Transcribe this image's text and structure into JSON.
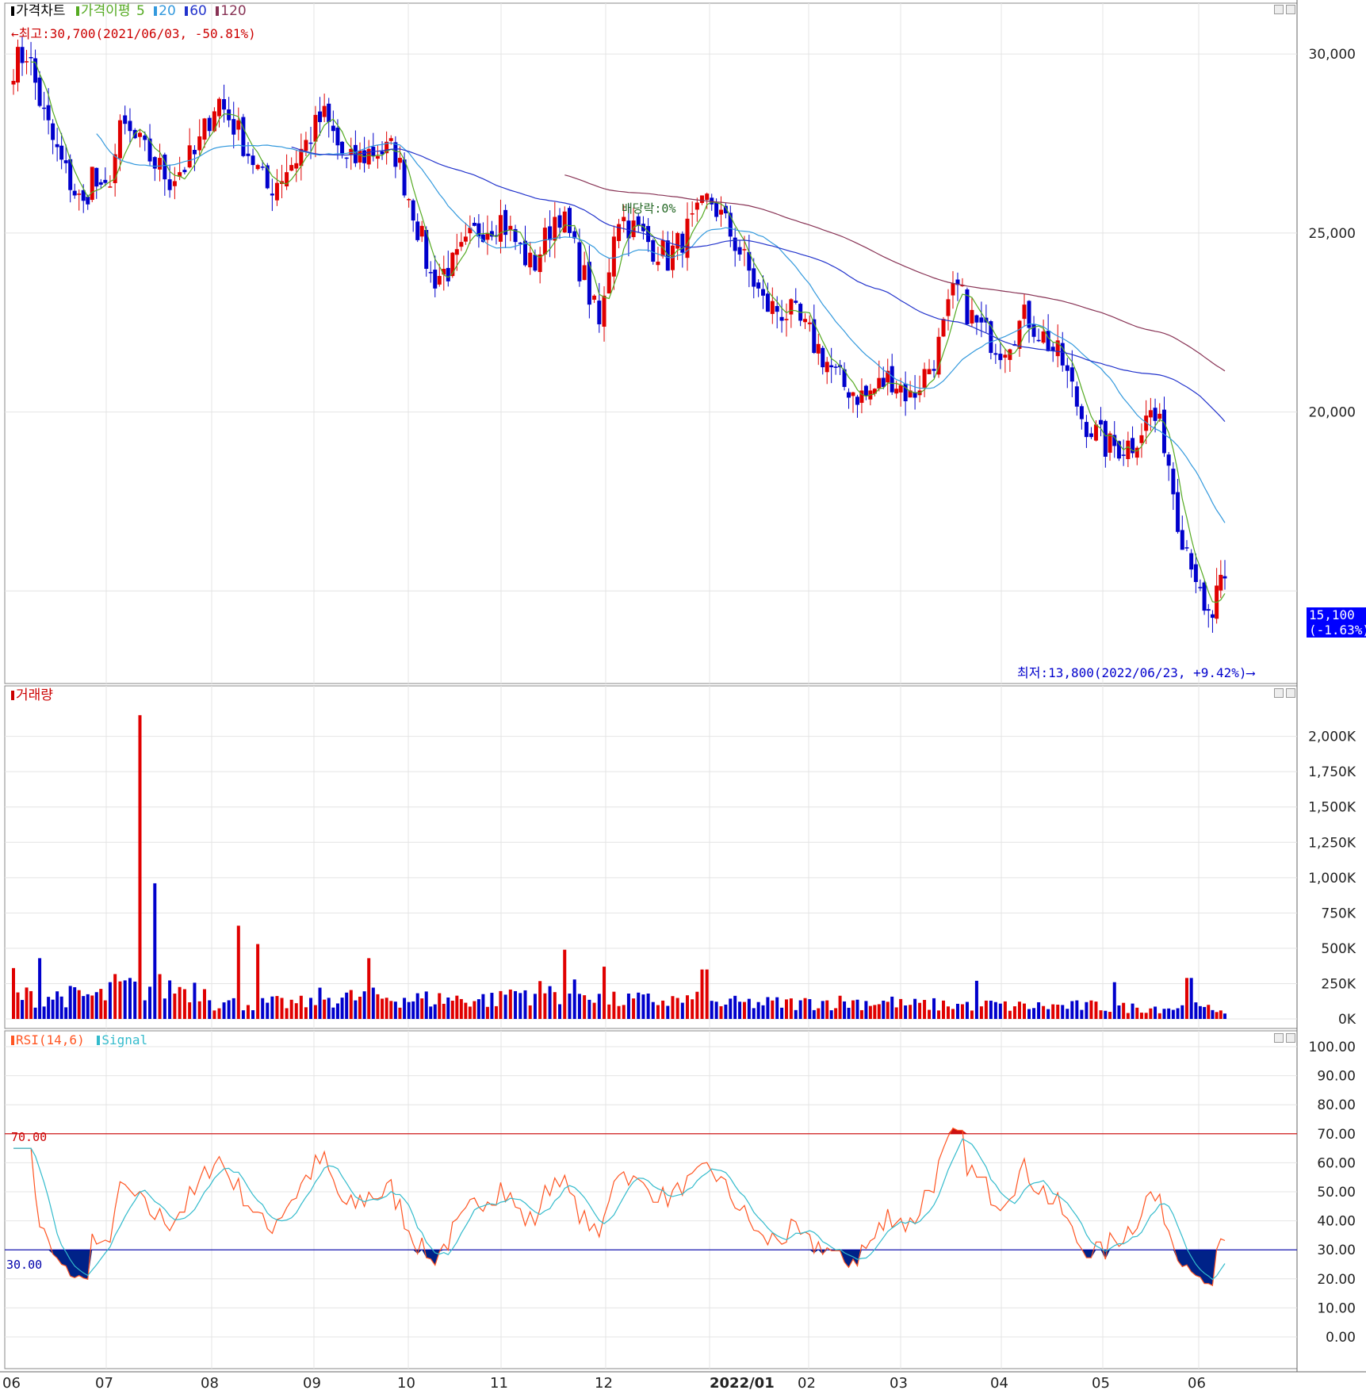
{
  "price_panel": {
    "legend": {
      "price_chart": "가격차트",
      "ma_label": "가격이평",
      "ma_periods": [
        "5",
        "20",
        "60",
        "120"
      ]
    },
    "high_annotation": "←최고:30,700(2021/06/03, -50.81%)",
    "low_annotation": "최저:13,800(2022/06/23, +9.42%)⟶",
    "event_marker": "배당락:0%",
    "last_price": "15,100",
    "last_change": "(-1.63%)"
  },
  "volume_panel": {
    "legend": "거래량"
  },
  "rsi_panel": {
    "legend_rsi": "RSI(14,6)",
    "legend_signal": "Signal",
    "upper_level_label": "70.00",
    "lower_level_label": "30.00"
  },
  "colors": {
    "up": "#e00000",
    "down": "#0000cc",
    "ma5": "#55aa22",
    "ma20": "#3399dd",
    "ma60": "#2233cc",
    "ma120": "#883355",
    "rsi": "#ff5522",
    "signal": "#33bbcc",
    "overbought_fill": "#cc1111",
    "oversold_fill": "#002288"
  },
  "chart_data": [
    {
      "type": "candlestick",
      "title": "가격차트",
      "y_ticks": [
        "30,000",
        "25,000",
        "20,000"
      ],
      "ylim": [
        13300,
        31200
      ],
      "x_ticks": [
        "06",
        "07",
        "08",
        "09",
        "10",
        "11",
        "12",
        "2022/01",
        "02",
        "03",
        "04",
        "05",
        "06"
      ],
      "series": [
        {
          "name": "Close",
          "anchors": [
            {
              "m": 0.0,
              "v": 29700
            },
            {
              "m": 0.15,
              "v": 30100
            },
            {
              "m": 0.3,
              "v": 28500
            },
            {
              "m": 0.5,
              "v": 27000
            },
            {
              "m": 0.75,
              "v": 25700
            },
            {
              "m": 0.85,
              "v": 26700
            },
            {
              "m": 0.95,
              "v": 25900
            },
            {
              "m": 1.0,
              "v": 26200
            },
            {
              "m": 1.15,
              "v": 28000
            },
            {
              "m": 1.35,
              "v": 27300
            },
            {
              "m": 1.6,
              "v": 26500
            },
            {
              "m": 1.85,
              "v": 27200
            },
            {
              "m": 2.05,
              "v": 28800
            },
            {
              "m": 2.3,
              "v": 27600
            },
            {
              "m": 2.55,
              "v": 26200
            },
            {
              "m": 2.85,
              "v": 27200
            },
            {
              "m": 3.1,
              "v": 28300
            },
            {
              "m": 3.35,
              "v": 26900
            },
            {
              "m": 3.6,
              "v": 27300
            },
            {
              "m": 3.85,
              "v": 27300
            },
            {
              "m": 4.05,
              "v": 25700
            },
            {
              "m": 4.25,
              "v": 23700
            },
            {
              "m": 4.5,
              "v": 24100
            },
            {
              "m": 4.75,
              "v": 25100
            },
            {
              "m": 5.0,
              "v": 25400
            },
            {
              "m": 5.3,
              "v": 24000
            },
            {
              "m": 5.55,
              "v": 25700
            },
            {
              "m": 5.8,
              "v": 23700
            },
            {
              "m": 5.95,
              "v": 22300
            },
            {
              "m": 6.1,
              "v": 25600
            },
            {
              "m": 6.35,
              "v": 24900
            },
            {
              "m": 6.6,
              "v": 24300
            },
            {
              "m": 6.9,
              "v": 25500
            },
            {
              "m": 7.0,
              "v": 26000
            },
            {
              "m": 7.25,
              "v": 24800
            },
            {
              "m": 7.55,
              "v": 23000
            },
            {
              "m": 7.85,
              "v": 22700
            },
            {
              "m": 8.15,
              "v": 21600
            },
            {
              "m": 8.35,
              "v": 20800
            },
            {
              "m": 8.6,
              "v": 20400
            },
            {
              "m": 8.9,
              "v": 21000
            },
            {
              "m": 9.1,
              "v": 20400
            },
            {
              "m": 9.35,
              "v": 21600
            },
            {
              "m": 9.55,
              "v": 23500
            },
            {
              "m": 9.75,
              "v": 22400
            },
            {
              "m": 10.0,
              "v": 21800
            },
            {
              "m": 10.25,
              "v": 22700
            },
            {
              "m": 10.5,
              "v": 21800
            },
            {
              "m": 10.6,
              "v": 21400
            },
            {
              "m": 10.8,
              "v": 19800
            },
            {
              "m": 11.05,
              "v": 19000
            },
            {
              "m": 11.3,
              "v": 19100
            },
            {
              "m": 11.5,
              "v": 20000
            },
            {
              "m": 11.65,
              "v": 19200
            },
            {
              "m": 11.8,
              "v": 16800
            },
            {
              "m": 11.95,
              "v": 15800
            },
            {
              "m": 12.05,
              "v": 14200
            },
            {
              "m": 12.15,
              "v": 14200
            },
            {
              "m": 12.22,
              "v": 15000
            },
            {
              "m": 12.3,
              "v": 15100
            }
          ]
        },
        {
          "name": "MA5"
        },
        {
          "name": "MA20"
        },
        {
          "name": "MA60"
        },
        {
          "name": "MA120"
        }
      ]
    },
    {
      "type": "bar",
      "title": "거래량",
      "y_ticks": [
        "2,000K",
        "1,750K",
        "1,500K",
        "1,250K",
        "1,000K",
        "750K",
        "500K",
        "250K",
        "0K"
      ],
      "ylim": [
        0,
        2200
      ],
      "baseline_k": [
        160,
        220,
        110,
        150,
        140,
        190,
        130,
        110,
        120,
        100,
        90,
        80,
        70
      ],
      "spikes": [
        {
          "m": 0.02,
          "k": 360
        },
        {
          "m": 0.3,
          "k": 430
        },
        {
          "m": 1.3,
          "k": 2150
        },
        {
          "m": 1.48,
          "k": 960
        },
        {
          "m": 2.25,
          "k": 660
        },
        {
          "m": 2.45,
          "k": 530
        },
        {
          "m": 3.6,
          "k": 430
        },
        {
          "m": 5.6,
          "k": 490
        },
        {
          "m": 5.98,
          "k": 370
        },
        {
          "m": 6.95,
          "k": 350
        },
        {
          "m": 9.75,
          "k": 270
        },
        {
          "m": 11.1,
          "k": 260
        },
        {
          "m": 11.9,
          "k": 290
        }
      ]
    },
    {
      "type": "line",
      "title": "RSI(14,6)",
      "y_ticks": [
        "100.00",
        "90.00",
        "80.00",
        "70.00",
        "60.00",
        "50.00",
        "40.00",
        "30.00",
        "20.00",
        "10.00",
        "0.00"
      ],
      "ylim": [
        0,
        100
      ],
      "levels": [
        70,
        30
      ],
      "series": [
        {
          "name": "RSI(14,6)"
        },
        {
          "name": "Signal"
        }
      ]
    }
  ]
}
